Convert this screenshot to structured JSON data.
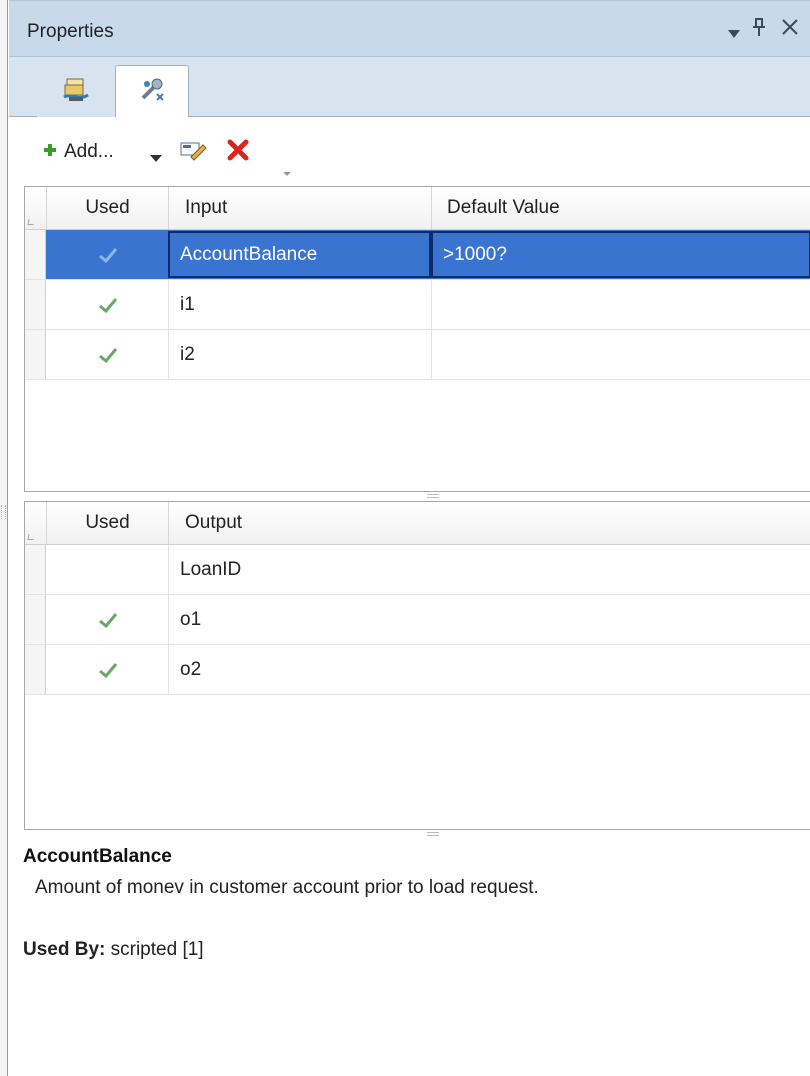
{
  "panel": {
    "title": "Properties",
    "controls": {
      "dropdown_icon": "dropdown-triangle",
      "pin_icon": "pin",
      "close_icon": "close-x"
    }
  },
  "tabs": [
    {
      "icon": "document-stack-icon",
      "active": false
    },
    {
      "icon": "tools-variables-icon",
      "active": true
    }
  ],
  "toolbar": {
    "add_label": "Add...",
    "add_icon": "green-plus",
    "edit_icon": "edit-pencil",
    "delete_icon": "red-x"
  },
  "inputs_grid": {
    "headers": {
      "used": "Used",
      "input": "Input",
      "default_value": "Default Value"
    },
    "rows": [
      {
        "used": true,
        "input": "AccountBalance",
        "default_value": ">1000?",
        "selected": true
      },
      {
        "used": true,
        "input": "i1",
        "default_value": "",
        "selected": false
      },
      {
        "used": true,
        "input": "i2",
        "default_value": "",
        "selected": false
      }
    ]
  },
  "outputs_grid": {
    "headers": {
      "used": "Used",
      "output": "Output"
    },
    "rows": [
      {
        "used": false,
        "output": "LoanID"
      },
      {
        "used": true,
        "output": "o1"
      },
      {
        "used": true,
        "output": "o2"
      }
    ]
  },
  "description": {
    "name": "AccountBalance",
    "text": "Amount of monev in customer account prior to load request.",
    "used_by_label": "Used By:",
    "used_by_value": " scripted [1]"
  },
  "colors": {
    "selection": "#3874d0",
    "titlebar": "#c9d9ec",
    "check": "#6aa86a"
  }
}
